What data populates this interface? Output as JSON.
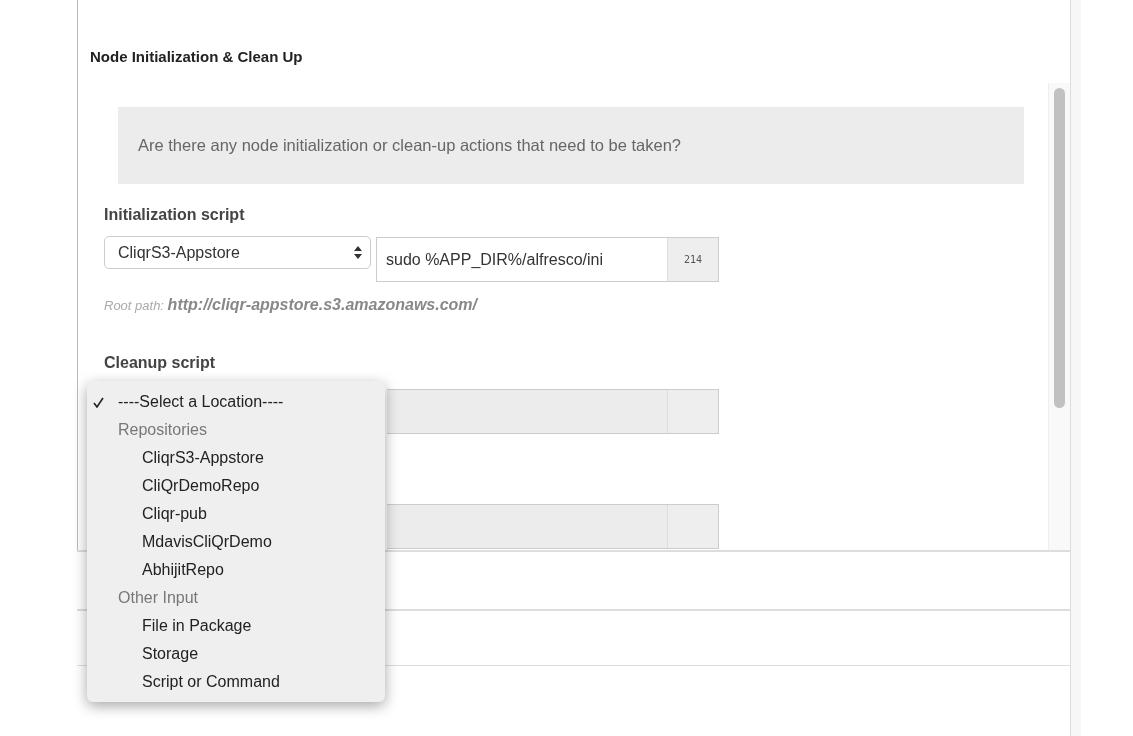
{
  "section": {
    "title": "Node Initialization & Clean Up",
    "question": "Are there any node initialization or clean-up actions that need to be taken?",
    "init_script": {
      "label": "Initialization script",
      "repository": "CliqrS3-Appstore",
      "value": "sudo %APP_DIR%/alfresco/ini",
      "counter": "214",
      "root_label": "Root path:",
      "root_url": "http://cliqr-appstore.s3.amazonaws.com/"
    },
    "cleanup_script": {
      "label": "Cleanup script",
      "disabled": true
    },
    "other_script": {
      "disabled": true
    }
  },
  "location_menu": [
    {
      "kind": "option",
      "label": "----Select a Location----",
      "checked": true
    },
    {
      "kind": "group",
      "label": "Repositories",
      "children": [
        {
          "label": "CliqrS3-Appstore",
          "checked": false
        },
        {
          "label": "CliQrDemoRepo",
          "checked": false
        },
        {
          "label": "Cliqr-pub",
          "checked": false
        },
        {
          "label": "MdavisCliQrDemo",
          "checked": false
        },
        {
          "label": "AbhijitRepo",
          "checked": false
        }
      ]
    },
    {
      "kind": "group",
      "label": "Other Input",
      "children": [
        {
          "label": "File in Package",
          "checked": false
        },
        {
          "label": "Storage",
          "checked": false
        },
        {
          "label": "Script or Command",
          "checked": false
        }
      ]
    }
  ]
}
